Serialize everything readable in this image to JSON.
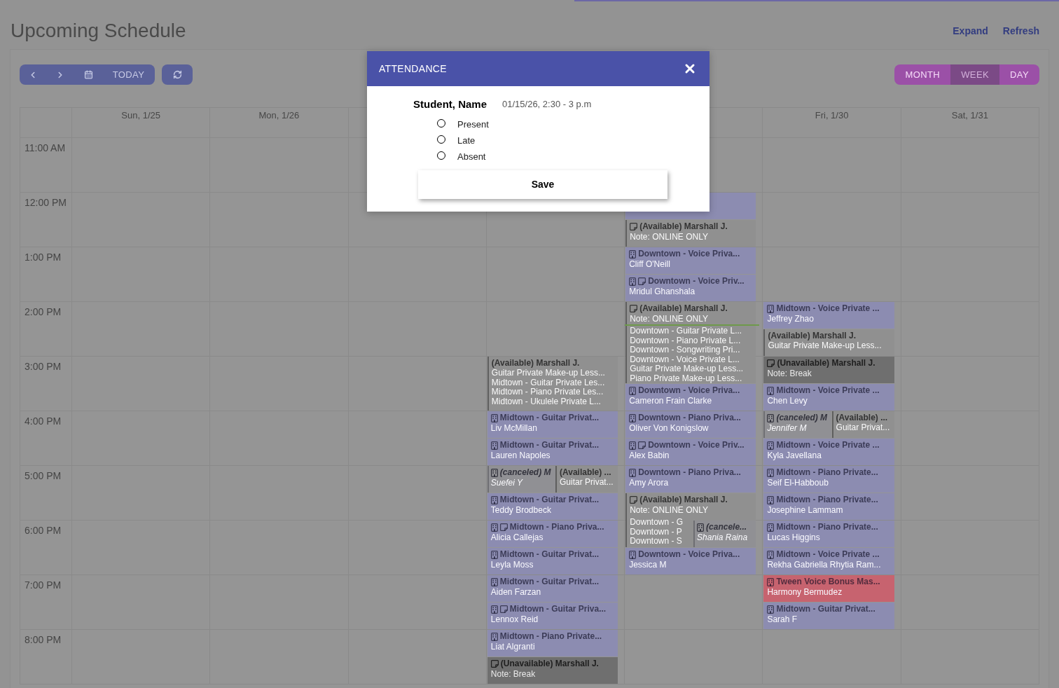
{
  "header": {
    "title": "Upcoming Schedule",
    "links": [
      "Expand",
      "Refresh"
    ]
  },
  "toolbar": {
    "today": "TODAY",
    "views": [
      {
        "label": "MONTH",
        "selected": false
      },
      {
        "label": "WEEK",
        "selected": true
      },
      {
        "label": "DAY",
        "selected": false
      }
    ]
  },
  "calendar": {
    "time_slots": [
      "11:00 AM",
      "12:00 PM",
      "1:00 PM",
      "2:00 PM",
      "3:00 PM",
      "4:00 PM",
      "5:00 PM",
      "6:00 PM",
      "7:00 PM",
      "8:00 PM"
    ],
    "days": [
      {
        "label": "Sun, 1/25",
        "today": false
      },
      {
        "label": "Mon, 1/26",
        "today": false
      },
      {
        "today": false
      },
      {
        "today": false,
        "events": [
          {
            "kind": "available",
            "note_icon": false,
            "title": "(Available) Marshall J.",
            "lines": [
              "Guitar Private Make-up Less...",
              "Midtown - Guitar Private Les...",
              "Midtown - Piano Private Les...",
              "Midtown - Ukulele Private L..."
            ]
          },
          {
            "kind": "lesson",
            "color": "#8c8cb1",
            "note_icon": false,
            "title": "Midtown - Guitar Privat...",
            "student": "Liv McMillan"
          },
          {
            "kind": "lesson",
            "color": "#8c8cb1",
            "note_icon": false,
            "title": "Midtown - Guitar Privat...",
            "student": "Lauren Napoles"
          },
          {
            "kind": "canceled",
            "note_icon": false,
            "title": "(canceled) M",
            "student": "Suefei Y",
            "overlay": {
              "kind": "available",
              "note_icon": false,
              "title": "(Available) ...",
              "lines": [
                "Guitar Privat..."
              ]
            }
          },
          {
            "kind": "lesson",
            "color": "#8c8cb1",
            "note_icon": false,
            "title": "Midtown - Guitar Privat...",
            "student": "Teddy Brodbeck"
          },
          {
            "kind": "lesson",
            "color": "#8c8cb1",
            "note_icon": true,
            "title": "Midtown - Piano Priva...",
            "student": "Alicia Callejas"
          },
          {
            "kind": "lesson",
            "color": "#8c8cb1",
            "note_icon": false,
            "title": "Midtown - Guitar Privat...",
            "student": "Leyla Moss"
          },
          {
            "kind": "lesson",
            "color": "#8c8cb1",
            "note_icon": false,
            "title": "Midtown - Guitar Privat...",
            "student": "Aiden Farzan"
          },
          {
            "kind": "lesson",
            "color": "#8c8cb1",
            "note_icon": true,
            "title": "Midtown - Guitar Priva...",
            "student": "Lennox Reid"
          },
          {
            "kind": "lesson",
            "color": "#8c8cb1",
            "note_icon": false,
            "title": "Midtown - Piano Private...",
            "student": "Liat Algranti"
          },
          {
            "kind": "unavailable",
            "note_icon": true,
            "title": "(Unavailable) Marshall J.",
            "note": "Note: Break"
          }
        ]
      },
      {
        "today": true,
        "events": [
          {
            "kind": "lesson",
            "color": "#8c8cb1"
          },
          {
            "kind": "available",
            "note_icon": true,
            "title": "(Available) Marshall J.",
            "note": "Note: ONLINE ONLY"
          },
          {
            "kind": "lesson",
            "color": "#8c8cb1",
            "note_icon": false,
            "title": "Downtown - Voice Priva...",
            "student": "Cliff O'Neill"
          },
          {
            "kind": "lesson",
            "color": "#8c8cb1",
            "note_icon": true,
            "title": "Downtown - Voice Priv...",
            "student": "Mridul Ghanshala"
          },
          {
            "kind": "available",
            "note_icon": true,
            "title": "(Available) Marshall J.",
            "note": "Note: ONLINE ONLY",
            "lines": [
              "Downtown - Guitar Private L...",
              "Downtown - Piano Private L...",
              "Downtown - Songwriting Pri...",
              "Downtown - Voice Private L...",
              "Guitar Private Make-up Less...",
              "Piano Private Make-up Less..."
            ]
          },
          {
            "kind": "lesson",
            "color": "#8c8cb1",
            "note_icon": false,
            "title": "Downtown - Voice Priva...",
            "student": "Cameron Frain Clarke"
          },
          {
            "kind": "lesson",
            "color": "#8c8cb1",
            "note_icon": false,
            "title": "Downtown - Piano Priva...",
            "student": "Oliver Von Konigslow"
          },
          {
            "kind": "lesson",
            "color": "#8c8cb1",
            "note_icon": true,
            "title": "Downtown - Voice Priv...",
            "student": "Alex Babin"
          },
          {
            "kind": "lesson",
            "color": "#8c8cb1",
            "note_icon": false,
            "title": "Downtown - Piano Priva...",
            "student": "Amy Arora"
          },
          {
            "kind": "available",
            "note_icon": true,
            "title": "(Available) Marshall J.",
            "note": "Note: ONLINE ONLY",
            "lines": [
              "Downtown - G",
              "Downtown - P",
              "Downtown - S"
            ],
            "overlay": {
              "kind": "canceled",
              "note_icon": false,
              "title": "(cancele...",
              "student": "Shania Raina"
            }
          },
          {
            "kind": "lesson",
            "color": "#8c8cb1",
            "note_icon": false,
            "title": "Downtown - Voice Priva...",
            "student": "Jessica M"
          }
        ]
      },
      {
        "label": "Fri, 1/30",
        "today": false,
        "events": [
          {
            "kind": "lesson",
            "color": "#8c8cb1",
            "note_icon": false,
            "title": "Midtown - Voice Private ...",
            "student": "Jeffrey Zhao"
          },
          {
            "kind": "available",
            "note_icon": false,
            "title": "(Available) Marshall J.",
            "lines": [
              "Guitar Private Make-up Less..."
            ]
          },
          {
            "kind": "unavailable",
            "note_icon": true,
            "title": "(Unavailable) Marshall J.",
            "note": "Note: Break"
          },
          {
            "kind": "lesson",
            "color": "#8c8cb1",
            "note_icon": false,
            "title": "Midtown - Voice Private ...",
            "student": "Chen Levy"
          },
          {
            "kind": "canceled",
            "note_icon": false,
            "title": "(canceled) M",
            "student": "Jennifer M",
            "overlay": {
              "kind": "available",
              "note_icon": false,
              "title": "(Available) ...",
              "lines": [
                "Guitar Privat..."
              ]
            }
          },
          {
            "kind": "lesson",
            "color": "#8c8cb1",
            "note_icon": false,
            "title": "Midtown - Voice Private ...",
            "student": "Kyla Javellana"
          },
          {
            "kind": "lesson",
            "color": "#8c8cb1",
            "note_icon": false,
            "title": "Midtown - Piano Private...",
            "student": "Seif El-Habboub"
          },
          {
            "kind": "lesson",
            "color": "#8c8cb1",
            "note_icon": false,
            "title": "Midtown - Piano Private...",
            "student": "Josephine Lammam"
          },
          {
            "kind": "lesson",
            "color": "#8c8cb1",
            "note_icon": false,
            "title": "Midtown - Piano Private...",
            "student": "Lucas Higgins"
          },
          {
            "kind": "lesson",
            "color": "#8c8cb1",
            "note_icon": false,
            "title": "Midtown - Voice Private ...",
            "student": "Rekha Gabriella Rhytia Ram..."
          },
          {
            "kind": "lesson",
            "color": "#c7636f",
            "note_icon": false,
            "title": "Tween Voice Bonus Mas...",
            "student": "Harmony Bermudez"
          },
          {
            "kind": "lesson",
            "color": "#8c8cb1",
            "note_icon": false,
            "title": "Midtown - Guitar Privat...",
            "student": "Sarah F"
          }
        ]
      },
      {
        "label": "Sat, 1/31",
        "today": false
      }
    ]
  },
  "attendance": {
    "title": "ATTENDANCE",
    "student": "Student, Name",
    "session": "01/15/26, 2:30 - 3 p.m",
    "options": [
      {
        "label": "Present",
        "selected": false
      },
      {
        "label": "Late",
        "selected": false
      },
      {
        "label": "Absent",
        "selected": false
      }
    ],
    "save": "Save"
  }
}
